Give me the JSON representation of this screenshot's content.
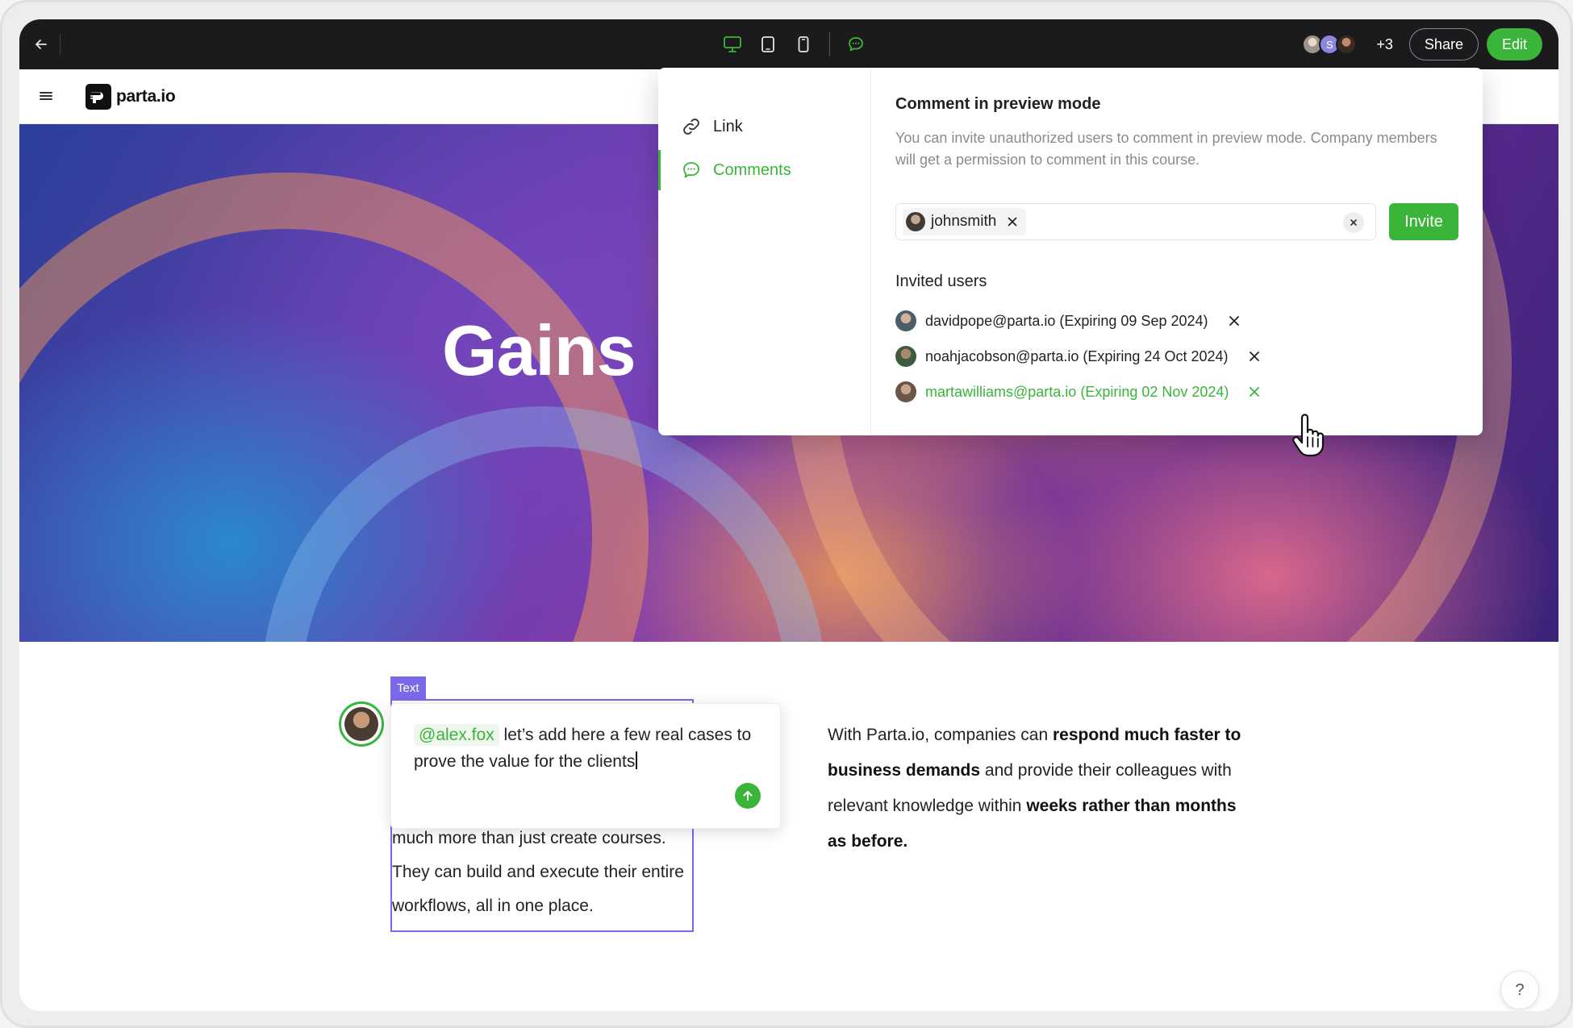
{
  "toolbar": {
    "back_icon": "arrow-left-icon",
    "device_modes": [
      "desktop-icon",
      "tablet-icon",
      "mobile-icon",
      "comment-icon"
    ],
    "active_mode": "desktop",
    "collaborators": [
      {
        "kind": "photo",
        "color": "#b9b4ad"
      },
      {
        "kind": "initial",
        "initial": "S",
        "color": "#8b86e0"
      },
      {
        "kind": "photo",
        "color": "#5a4a40"
      }
    ],
    "more_collaborators": "+3",
    "share_label": "Share",
    "edit_label": "Edit",
    "accent": "#3ab53a"
  },
  "app_header": {
    "menu_icon": "hamburger-icon",
    "logo_text": "parta.io"
  },
  "hero": {
    "title": "Gains"
  },
  "content": {
    "block_tag": "Text",
    "block_text": "much more than just create courses. They can build and execute their entire workflows, all in one place.",
    "comment": {
      "mention": "@alex.fox",
      "text": "let’s add here a few real cases to prove the value for the clients"
    },
    "paragraph": {
      "p1": "With Parta.io, companies can ",
      "b1": "respond much faster to business demands",
      "p2": " and provide their colleagues with relevant knowledge within ",
      "b2": "weeks rather than months as before."
    },
    "help_label": "?"
  },
  "share_popover": {
    "nav": [
      {
        "label": "Link",
        "icon": "link-icon"
      },
      {
        "label": "Comments",
        "icon": "comment-icon",
        "active": true
      }
    ],
    "title": "Comment in preview mode",
    "description": "You can invite unauthorized users to comment in preview mode. Company members will get a permission to comment in this course.",
    "invite_chip": "johnsmith",
    "invite_button": "Invite",
    "invited_title": "Invited users",
    "invited_users": [
      {
        "label": "davidpope@parta.io (Expiring 09 Sep 2024)",
        "avatar_color": "#4a5e6a"
      },
      {
        "label": "noahjacobson@parta.io (Expiring 24 Oct 2024)",
        "avatar_color": "#3f5a3e"
      },
      {
        "label": "martawilliams@parta.io (Expiring 02 Nov 2024)",
        "avatar_color": "#6b5448",
        "hovered": true
      }
    ]
  }
}
